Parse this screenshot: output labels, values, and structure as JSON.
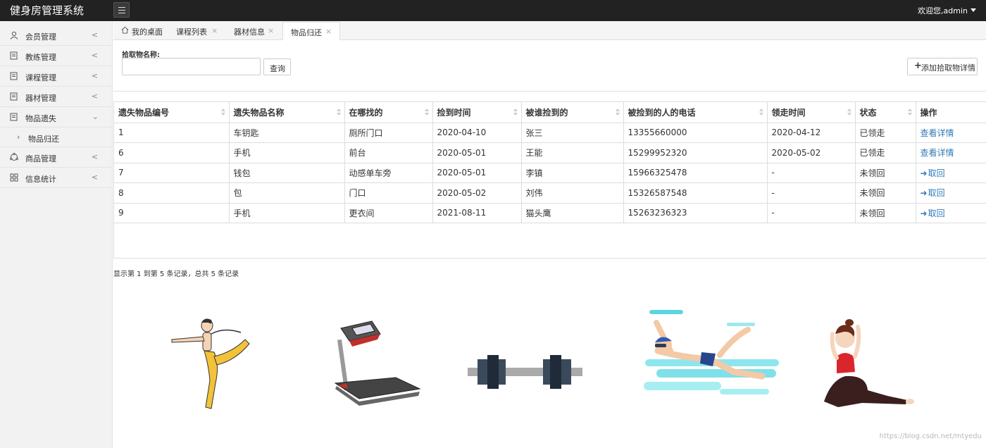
{
  "app": {
    "title": "健身房管理系统",
    "welcome": "欢迎您,admin"
  },
  "sidebar": {
    "items": [
      {
        "label": "会员管理",
        "icon": "user-icon"
      },
      {
        "label": "教练管理",
        "icon": "document-icon"
      },
      {
        "label": "课程管理",
        "icon": "document-icon"
      },
      {
        "label": "器材管理",
        "icon": "document-icon"
      },
      {
        "label": "物品遗失",
        "icon": "document-icon",
        "expanded": true
      },
      {
        "label": "商品管理",
        "icon": "cube-icon"
      },
      {
        "label": "信息统计",
        "icon": "grid-icon"
      }
    ],
    "sub_items": [
      {
        "label": "物品归还"
      }
    ]
  },
  "tabs": [
    {
      "label": "我的桌面",
      "icon": "home-icon"
    },
    {
      "label": "课程列表"
    },
    {
      "label": "器材信息"
    },
    {
      "label": "物品归还",
      "active": true
    }
  ],
  "search": {
    "label": "拾取物名称:",
    "value": "",
    "button": "查询"
  },
  "add_button": "添加拾取物详情",
  "table": {
    "columns": [
      "遗失物品编号",
      "遗失物品名称",
      "在哪找的",
      "捡到时间",
      "被谁捡到的",
      "被捡到的人的电话",
      "领走时间",
      "状态",
      "操作"
    ],
    "rows": [
      {
        "cells": [
          "1",
          "车钥匙",
          "厕所门口",
          "2020-04-10",
          "张三",
          "13355660000",
          "2020-04-12",
          "已领走"
        ],
        "action": "查看详情",
        "action_type": "view"
      },
      {
        "cells": [
          "6",
          "手机",
          "前台",
          "2020-05-01",
          "王能",
          "15299952320",
          "2020-05-02",
          "已领走"
        ],
        "action": "查看详情",
        "action_type": "view"
      },
      {
        "cells": [
          "7",
          "钱包",
          "动感单车旁",
          "2020-05-01",
          "李镇",
          "15966325478",
          "-",
          "未领回"
        ],
        "action": "取回",
        "action_type": "retrieve"
      },
      {
        "cells": [
          "8",
          "包",
          "门口",
          "2020-05-02",
          "刘伟",
          "15326587548",
          "-",
          "未领回"
        ],
        "action": "取回",
        "action_type": "retrieve"
      },
      {
        "cells": [
          "9",
          "手机",
          "更衣间",
          "2021-08-11",
          "猫头鹰",
          "15263236323",
          "-",
          "未领回"
        ],
        "action": "取回",
        "action_type": "retrieve"
      }
    ]
  },
  "pagination": {
    "summary": "显示第 1 到第 5 条记录，总共 5 条记录"
  },
  "watermark": "https://blog.csdn.net/mtyedu",
  "colors": {
    "topbar": "#222222",
    "link": "#337ab7",
    "sidebar_bg": "#f2f2f2"
  }
}
